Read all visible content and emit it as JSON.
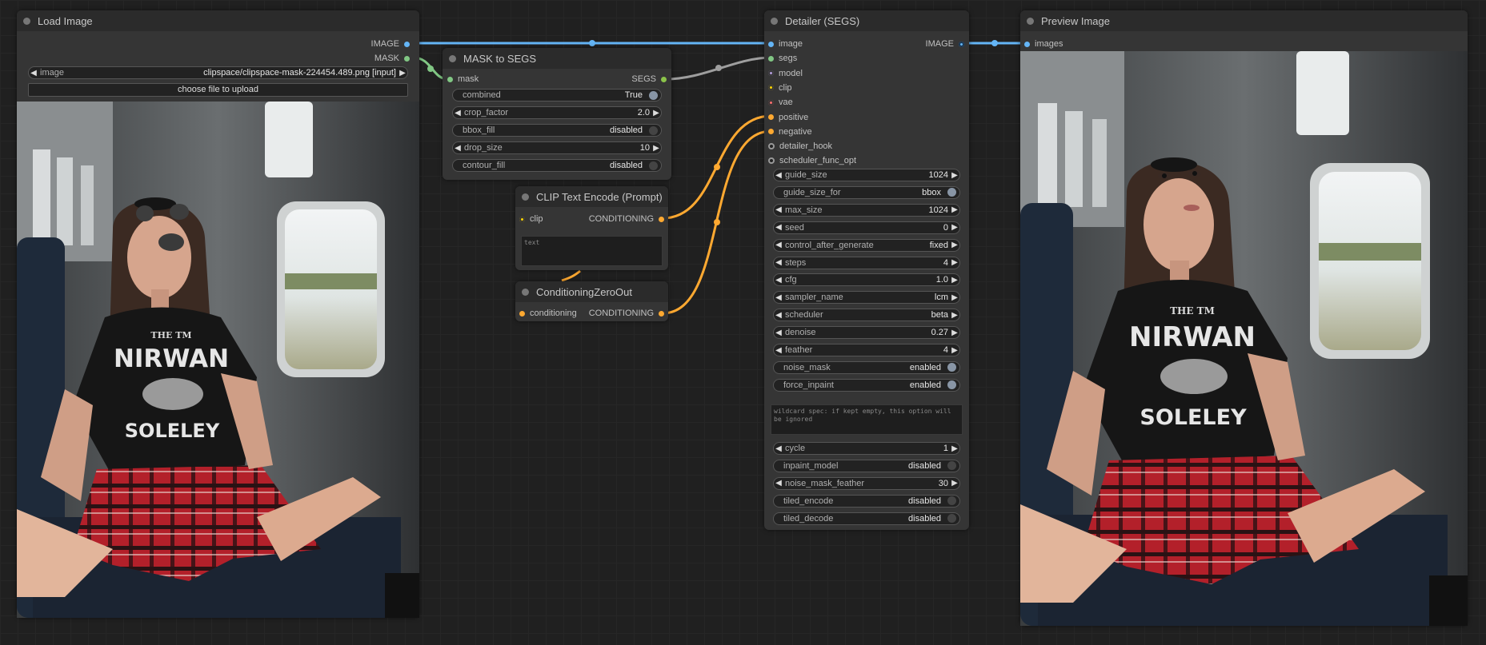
{
  "colors": {
    "image": "#64b5f6",
    "mask": "#81c784",
    "segs": "#8bc34a",
    "conditioning": "#ffa931",
    "clip": "#ffd500",
    "vae": "#ff6e6e",
    "model": "#b39ddb"
  },
  "load_image": {
    "title": "Load Image",
    "outputs": [
      "IMAGE",
      "MASK"
    ],
    "image_widget": {
      "label": "image",
      "value": "clipspace/clipspace-mask-224454.489.png [input]"
    },
    "upload_button": "choose file to upload"
  },
  "mask_to_segs": {
    "title": "MASK to SEGS",
    "input": "mask",
    "output": "SEGS",
    "widgets": [
      {
        "label": "combined",
        "value": "True",
        "kind": "toggle",
        "on": true
      },
      {
        "label": "crop_factor",
        "value": "2.0",
        "kind": "number"
      },
      {
        "label": "bbox_fill",
        "value": "disabled",
        "kind": "toggle",
        "on": false
      },
      {
        "label": "drop_size",
        "value": "10",
        "kind": "number"
      },
      {
        "label": "contour_fill",
        "value": "disabled",
        "kind": "toggle",
        "on": false
      }
    ]
  },
  "clip_text_encode": {
    "title": "CLIP Text Encode (Prompt)",
    "input": "clip",
    "output": "CONDITIONING",
    "placeholder": "text"
  },
  "cond_zero_out": {
    "title": "ConditioningZeroOut",
    "input": "conditioning",
    "output": "CONDITIONING"
  },
  "detailer": {
    "title": "Detailer (SEGS)",
    "output": "IMAGE",
    "inputs": [
      "image",
      "segs",
      "model",
      "clip",
      "vae",
      "positive",
      "negative",
      "detailer_hook",
      "scheduler_func_opt"
    ],
    "widgets": [
      {
        "label": "guide_size",
        "value": "1024",
        "kind": "number"
      },
      {
        "label": "guide_size_for",
        "value": "bbox",
        "kind": "toggle",
        "on": true
      },
      {
        "label": "max_size",
        "value": "1024",
        "kind": "number"
      },
      {
        "label": "seed",
        "value": "0",
        "kind": "number"
      },
      {
        "label": "control_after_generate",
        "value": "fixed",
        "kind": "number"
      },
      {
        "label": "steps",
        "value": "4",
        "kind": "number"
      },
      {
        "label": "cfg",
        "value": "1.0",
        "kind": "number"
      },
      {
        "label": "sampler_name",
        "value": "lcm",
        "kind": "number"
      },
      {
        "label": "scheduler",
        "value": "beta",
        "kind": "number"
      },
      {
        "label": "denoise",
        "value": "0.27",
        "kind": "number"
      },
      {
        "label": "feather",
        "value": "4",
        "kind": "number"
      },
      {
        "label": "noise_mask",
        "value": "enabled",
        "kind": "toggle",
        "on": true
      },
      {
        "label": "force_inpaint",
        "value": "enabled",
        "kind": "toggle",
        "on": true
      }
    ],
    "wildcard_placeholder": "wildcard spec: if kept empty, this option will be ignored",
    "widgets2": [
      {
        "label": "cycle",
        "value": "1",
        "kind": "number"
      },
      {
        "label": "inpaint_model",
        "value": "disabled",
        "kind": "toggle",
        "on": false
      },
      {
        "label": "noise_mask_feather",
        "value": "30",
        "kind": "number"
      },
      {
        "label": "tiled_encode",
        "value": "disabled",
        "kind": "toggle",
        "on": false
      },
      {
        "label": "tiled_decode",
        "value": "disabled",
        "kind": "toggle",
        "on": false
      }
    ]
  },
  "preview_image": {
    "title": "Preview Image",
    "input": "images"
  },
  "photo": {
    "shirt_line1": "THE TM",
    "shirt_line2": "NIRWAN",
    "shirt_line3": "SOLELEY"
  }
}
